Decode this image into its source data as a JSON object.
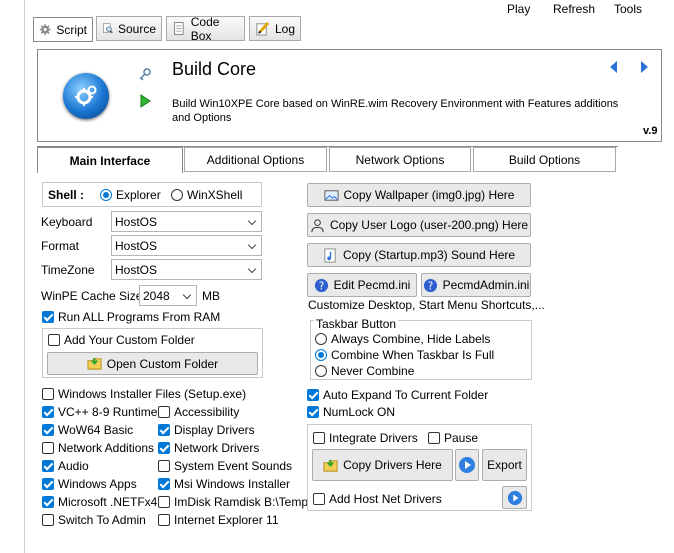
{
  "menu": {
    "play": "Play",
    "refresh": "Refresh",
    "tools": "Tools"
  },
  "tabs": [
    {
      "label": "Script",
      "icon": "gear-icon"
    },
    {
      "label": "Source",
      "icon": "magnifier-icon"
    },
    {
      "label": "Code Box",
      "icon": "document-icon"
    },
    {
      "label": "Log",
      "icon": "pencil-icon"
    }
  ],
  "header": {
    "title": "Build Core",
    "description": "Build Win10XPE Core based on WinRE.wim Recovery Environment with Features additions and Options",
    "version": "v.9"
  },
  "inner_tabs": [
    "Main Interface",
    "Additional Options",
    "Network Options",
    "Build Options"
  ],
  "shell": {
    "label": "Shell :",
    "options": [
      "Explorer",
      "WinXShell"
    ],
    "selected": "Explorer"
  },
  "fields": [
    {
      "label": "Keyboard",
      "value": "HostOS"
    },
    {
      "label": "Format",
      "value": "HostOS"
    },
    {
      "label": "TimeZone",
      "value": "HostOS"
    }
  ],
  "cache": {
    "label": "WinPE Cache Size",
    "value": "2048",
    "unit": "MB"
  },
  "run_all": {
    "label": "Run ALL Programs From RAM",
    "checked": true
  },
  "custom_folder": {
    "label": "Add Your Custom Folder",
    "checked": false,
    "button": "Open Custom Folder"
  },
  "left_checks": [
    {
      "label": "Windows Installer Files (Setup.exe)",
      "checked": false
    },
    {
      "label": "VC++ 8-9 Runtime",
      "checked": true
    },
    {
      "label": "WoW64 Basic",
      "checked": true
    },
    {
      "label": "Network Additions",
      "checked": false
    },
    {
      "label": "Audio",
      "checked": true
    },
    {
      "label": "Windows Apps",
      "checked": true
    },
    {
      "label": "Microsoft .NETFx4",
      "checked": true
    },
    {
      "label": "Switch To Admin",
      "checked": false
    }
  ],
  "mid_checks": [
    {
      "label": "Accessibility",
      "checked": false
    },
    {
      "label": "Display Drivers",
      "checked": true
    },
    {
      "label": "Network Drivers",
      "checked": true
    },
    {
      "label": "System Event Sounds",
      "checked": false
    },
    {
      "label": "Msi Windows Installer",
      "checked": true
    },
    {
      "label": "ImDisk Ramdisk B:\\Temp",
      "checked": false
    },
    {
      "label": "Internet Explorer 11",
      "checked": false
    }
  ],
  "right": {
    "copy_wallpaper": "Copy Wallpaper (img0.jpg) Here",
    "copy_logo": "Copy User Logo (user-200.png) Here",
    "copy_sound": "Copy (Startup.mp3) Sound Here",
    "edit_pecmd": "Edit Pecmd.ini",
    "pecmdadmin": "PecmdAdmin.ini",
    "customize_text": "Customize Desktop, Start Menu Shortcuts,...",
    "taskbar": {
      "title": "Taskbar Button",
      "options": [
        "Always Combine, Hide Labels",
        "Combine When Taskbar Is Full",
        "Never Combine"
      ],
      "selected": "Combine When Taskbar Is Full"
    },
    "auto_expand": {
      "label": "Auto Expand To Current Folder",
      "checked": true
    },
    "numlock": {
      "label": "NumLock ON",
      "checked": true
    },
    "integrate": {
      "label": "Integrate Drivers",
      "checked": false
    },
    "pause": {
      "label": "Pause",
      "checked": false
    },
    "copy_drivers": "Copy Drivers Here",
    "export": "Export",
    "host_net": {
      "label": "Add Host Net Drivers",
      "checked": false
    }
  }
}
